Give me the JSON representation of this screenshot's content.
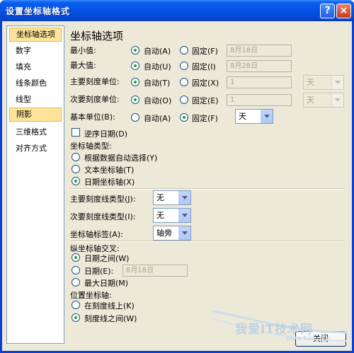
{
  "window": {
    "title": "设置坐标轴格式"
  },
  "titlebar": {
    "help": "?",
    "close": "×"
  },
  "nav": {
    "items": [
      "坐标轴选项",
      "数字",
      "填充",
      "线条颜色",
      "线型",
      "阴影",
      "三维格式",
      "对齐方式"
    ],
    "selected": [
      0,
      5
    ]
  },
  "heading": "坐标轴选项",
  "min": {
    "label": "最小值:",
    "auto": "自动(A)",
    "fixed": "固定(F)",
    "value": "8月18日"
  },
  "max": {
    "label": "最大值:",
    "auto": "自动(U)",
    "fixed": "固定(I)",
    "value": "8月28日"
  },
  "major": {
    "label": "主要刻度单位:",
    "auto": "自动(T)",
    "fixed": "固定(X)",
    "value": "1",
    "unit": "天"
  },
  "minor": {
    "label": "次要刻度单位:",
    "auto": "自动(O)",
    "fixed": "固定(E)",
    "value": "1",
    "unit": "天"
  },
  "base": {
    "label": "基本单位(B):",
    "auto": "自动(A)",
    "fixed": "固定(F)",
    "unit": "天"
  },
  "reverse": "逆序日期(D)",
  "axis_type": {
    "label": "坐标轴类型:",
    "opt1": "根据数据自动选择(Y)",
    "opt2": "文本坐标轴(T)",
    "opt3": "日期坐标轴(X)"
  },
  "major_tick": {
    "label": "主要刻度线类型(J):",
    "value": "无"
  },
  "minor_tick": {
    "label": "次要刻度线类型(I):",
    "value": "无"
  },
  "tick_label": {
    "label": "坐标轴标签(A):",
    "value": "轴旁"
  },
  "cross": {
    "label": "纵坐标轴交叉:",
    "between": "日期之间(W)",
    "date": "日期(E):",
    "date_value": "8月18日",
    "max": "最大日期(M)"
  },
  "position": {
    "label": "位置坐标轴:",
    "on": "在刻度线上(K)",
    "between": "刻度线之间(W)"
  },
  "buttons": {
    "close": "关闭"
  },
  "watermark": {
    "text": "我爱IT技术网",
    "url": "www.52ij.com"
  }
}
